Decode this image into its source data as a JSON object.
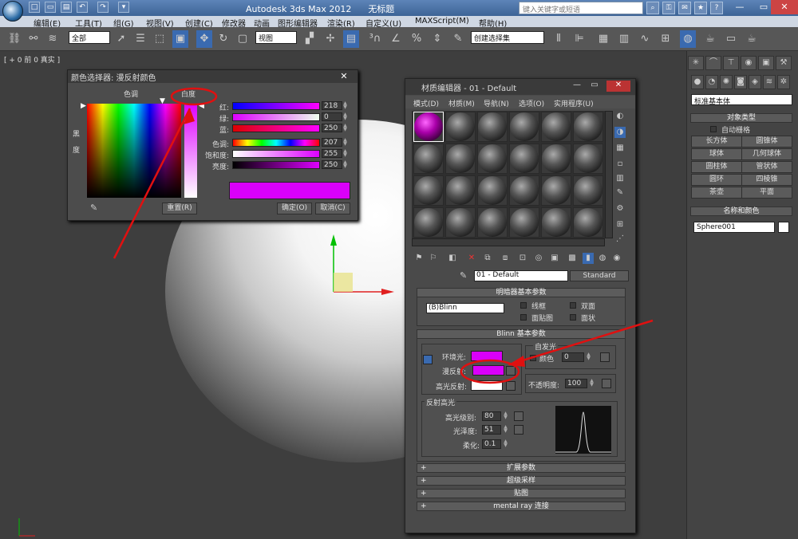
{
  "titlebar": {
    "app_title": "Autodesk 3ds Max  2012",
    "doc_title": "无标题",
    "search_placeholder": "键入关键字或短语",
    "quick_access": [
      "□",
      "▭",
      "▤",
      "↶",
      "↷",
      "▾"
    ],
    "window_buttons": [
      "—",
      "▭",
      "✕"
    ]
  },
  "menubar": {
    "items": [
      "编辑(E)",
      "工具(T)",
      "组(G)",
      "视图(V)",
      "创建(C)",
      "修改器",
      "动画",
      "图形编辑器",
      "渲染(R)",
      "自定义(U)",
      "MAXScript(M)",
      "帮助(H)"
    ]
  },
  "toolbar": {
    "filter_value": "全部",
    "view_value": "视图",
    "named_sel_value": "创建选择集"
  },
  "viewport": {
    "label": "[ + 0 前 0 真实 ]"
  },
  "command_panel": {
    "primitive_type": "标准基本体",
    "object_type_header": "对象类型",
    "autogrid_label": "自动栅格",
    "buttons": [
      "长方体",
      "圆锥体",
      "球体",
      "几何球体",
      "圆柱体",
      "管状体",
      "圆环",
      "四棱锥",
      "茶壶",
      "平面"
    ],
    "name_color_header": "名称和颜色",
    "object_name": "Sphere001"
  },
  "color_dialog": {
    "title": "颜色选择器: 漫反射颜色",
    "hue_label": "色调",
    "whiteness_label": "白度",
    "blackness_label": "黑\n\n度",
    "channels": [
      {
        "label": "红:",
        "value": "218",
        "color": "#d800fa"
      },
      {
        "label": "绿:",
        "value": "0",
        "color": "#ff00ff"
      },
      {
        "label": "蓝:",
        "value": "250",
        "color": "#dc0000"
      },
      {
        "label": "色调:",
        "value": "207",
        "color": "#ff00ff"
      },
      {
        "label": "饱和度:",
        "value": "255",
        "color": "#dd00ff"
      },
      {
        "label": "亮度:",
        "value": "250",
        "color": "#d800fa"
      }
    ],
    "reset_button": "重置(R)",
    "ok_button": "确定(O)",
    "cancel_button": "取消(C)",
    "current_color": "#da00fa"
  },
  "material_editor": {
    "title": "材质编辑器 - 01 - Default",
    "menu": [
      "模式(D)",
      "材质(M)",
      "导航(N)",
      "选项(O)",
      "实用程序(U)"
    ],
    "material_name": "01 - Default",
    "material_type": "Standard",
    "shader_header": "明暗器基本参数",
    "shader_value": "(B)Blinn",
    "shader_opts": [
      "线框",
      "双面",
      "面贴图",
      "面状"
    ],
    "blinn_header": "Blinn 基本参数",
    "self_illum_label": "自发光",
    "color_label": "颜色",
    "self_illum_value": "0",
    "ambient_label": "环境光:",
    "diffuse_label": "漫反射:",
    "specular_label": "高光反射:",
    "opacity_label": "不透明度:",
    "opacity_value": "100",
    "spec_highlights_label": "反射高光",
    "spec_level_label": "高光级别:",
    "spec_level_value": "80",
    "gloss_label": "光泽度:",
    "gloss_value": "51",
    "soften_label": "柔化:",
    "soften_value": "0.1",
    "ambient_color": "#da00fa",
    "diffuse_color": "#da00fa",
    "specular_color": "#ffffff",
    "rollouts": [
      "扩展参数",
      "超级采样",
      "贴图",
      "mental ray 连接"
    ]
  },
  "annotation_color": "#e01010"
}
